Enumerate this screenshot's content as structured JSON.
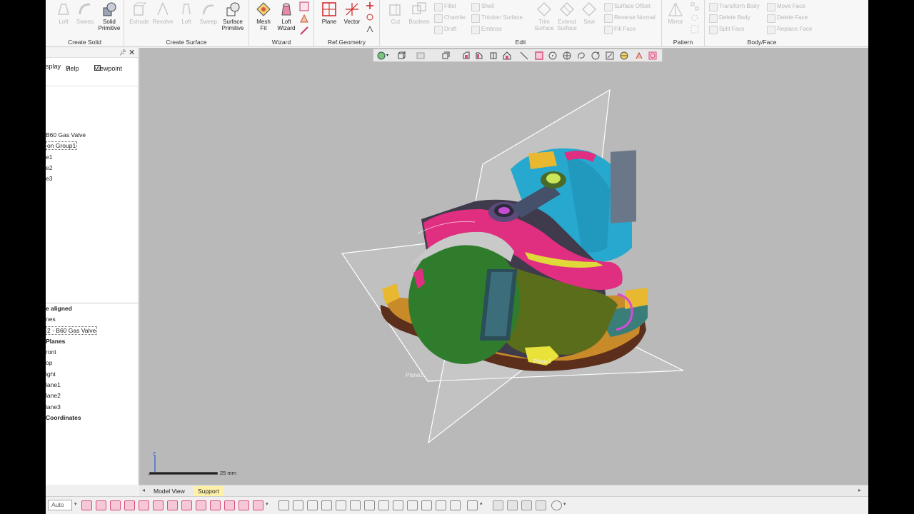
{
  "ribbon": {
    "groups": [
      {
        "label": "Create Solid"
      },
      {
        "label": "Create Surface"
      },
      {
        "label": "Wizard"
      },
      {
        "label": "Ref.Geometry"
      },
      {
        "label": "Edit"
      },
      {
        "label": "Pattern"
      },
      {
        "label": "Body/Face"
      }
    ],
    "create_solid": {
      "loft": "Loft",
      "sweep": "Sweep",
      "solid_primitive_1": "Solid",
      "solid_primitive_2": "Primitive"
    },
    "create_surface": {
      "extrude": "Extrude",
      "revolve": "Revolve",
      "loft": "Loft",
      "sweep": "Sweep",
      "surface_primitive_1": "Surface",
      "surface_primitive_2": "Primitive"
    },
    "wizard": {
      "mesh_fit_1": "Mesh",
      "mesh_fit_2": "Fit",
      "loft_wizard_1": "Loft",
      "loft_wizard_2": "Wizard"
    },
    "ref_geometry": {
      "plane": "Plane",
      "vector": "Vector"
    },
    "edit": {
      "cut": "Cut",
      "boolean": "Boolean",
      "fillet": "Fillet",
      "chamfer": "Chamfer",
      "draft": "Draft",
      "shell": "Shell",
      "thicken_surface": "Thicken Surface",
      "emboss": "Emboss",
      "trim_surface_1": "Trim",
      "trim_surface_2": "Surface",
      "extend_surface_1": "Extend",
      "extend_surface_2": "Surface",
      "sew": "Sew",
      "surface_offset": "Surface Offset",
      "reverse_normal": "Reverse Normal",
      "fill_face": "Fill Face"
    },
    "pattern": {
      "mirror": "Mirror"
    },
    "body_face": {
      "transform_body": "Transform Body",
      "delete_body": "Delete Body",
      "split_face": "Split Face",
      "move_face": "Move Face",
      "delete_face": "Delete Face",
      "replace_face": "Replace Face"
    }
  },
  "left_panel": {
    "tabs": {
      "display": "splay",
      "help": "Help",
      "viewpoint": "Viewpoint"
    },
    "tree": [
      "B60 Gas Valve",
      "on Group1",
      "e1",
      "e2",
      "e3"
    ],
    "tree2": [
      "e aligned",
      "nes",
      "2 - B60 Gas Valve",
      "Planes",
      "ront",
      "op",
      "ight",
      "lane1",
      "lane2",
      "lane3",
      "Coordinates"
    ]
  },
  "viewport": {
    "plane_label_1": "Plane1",
    "plane_label_2": "Plane1",
    "scale_label": "25 mm",
    "axis_label": "Z"
  },
  "bottom_tabs": {
    "model_view": "Model View",
    "support": "Support"
  },
  "bottom_bar": {
    "auto": "Auto"
  },
  "colors": {
    "viewport_bg": "#b9b9b9",
    "model_green": "#2f7d2c",
    "model_cyan": "#27a9cf",
    "model_magenta": "#e02e80",
    "model_brown": "#5b2f1c",
    "support_tab": "#fff2a8",
    "pink_tool": "#d94f7e"
  }
}
